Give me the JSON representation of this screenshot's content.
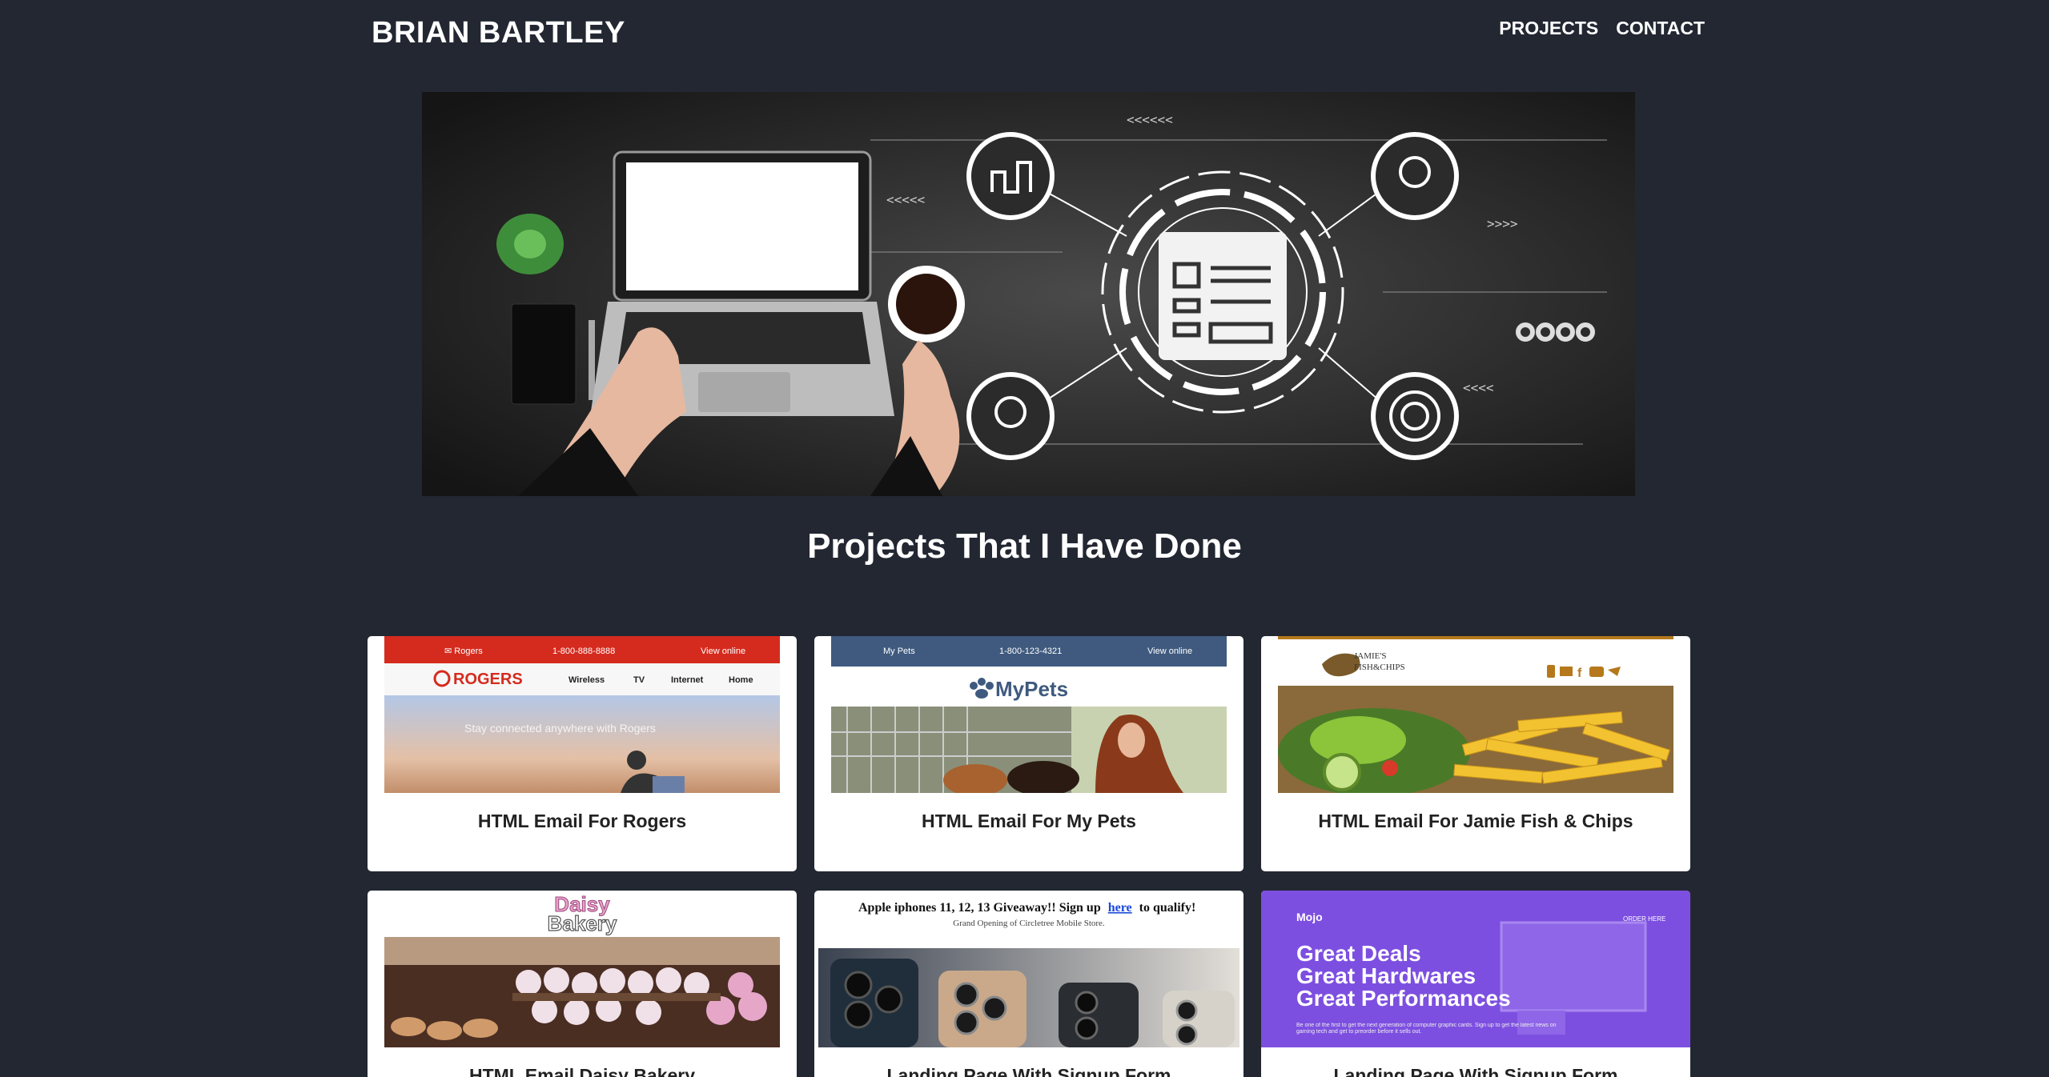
{
  "nav": {
    "brand": "BRIAN BARTLEY",
    "links": [
      "PROJECTS",
      "CONTACT"
    ]
  },
  "section_title": "Projects That I Have Done",
  "cards": [
    {
      "caption": "HTML Email For Rogers",
      "thumb": {
        "topbar_left": "Rogers",
        "topbar_phone": "1-800-888-8888",
        "topbar_right": "View online",
        "logo": "ROGERS",
        "menu": [
          "Wireless",
          "TV",
          "Internet",
          "Home"
        ],
        "banner": "Stay connected anywhere with Rogers"
      }
    },
    {
      "caption": "HTML Email For My Pets",
      "thumb": {
        "topbar_left": "My Pets",
        "topbar_phone": "1-800-123-4321",
        "topbar_right": "View online",
        "logo": "MyPets"
      }
    },
    {
      "caption": "HTML Email For Jamie Fish & Chips",
      "thumb": {
        "logo_line1": "JAMIE'S",
        "logo_line2": "FISH&CHIPS"
      }
    },
    {
      "caption": "HTML Email Daisy Bakery",
      "thumb": {
        "logo_line1": "Daisy",
        "logo_line2": "Bakery"
      }
    },
    {
      "caption": "Landing Page With Signup Form",
      "thumb": {
        "headline": "Apple iphones 11, 12, 13 Giveaway!! Sign up",
        "headline_link": "here",
        "headline_end": "to qualify!",
        "subline": "Grand Opening of Circletree Mobile Store."
      }
    },
    {
      "caption": "Landing Page With Signup Form",
      "thumb": {
        "brand": "Mojo",
        "order": "ORDER HERE",
        "lines": [
          "Great Deals",
          "Great Hardwares",
          "Great Performances"
        ],
        "fine_print": "Be one of the first to get the next generation of computer graphic cards. Sign up to get the latest news on gaming tech and get to preorder before it sells out."
      }
    }
  ],
  "colors": {
    "background": "#222732",
    "rogers_red": "#d52b1e",
    "mypets_blue": "#3f5a7e",
    "jamie_orange": "#b5791c",
    "mojo_purple": "#7d4fe0"
  }
}
